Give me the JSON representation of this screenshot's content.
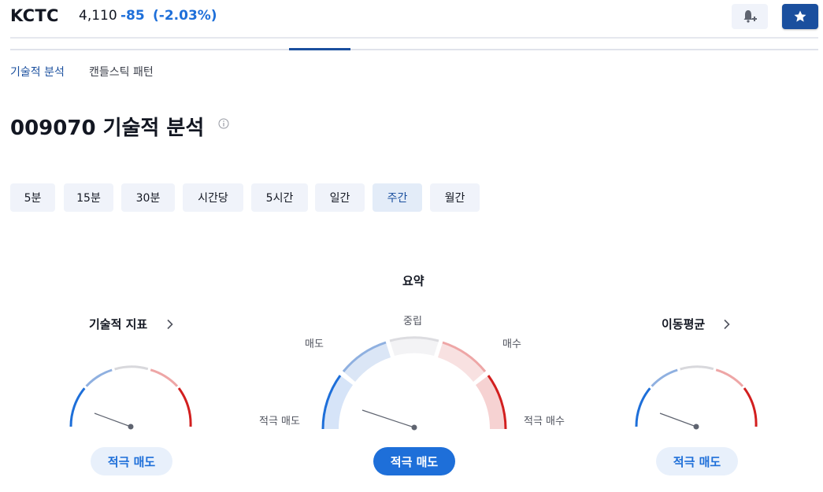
{
  "header": {
    "ticker": "KCTC",
    "price": "4,110",
    "change": "-85",
    "change_pct": "(-2.03%)",
    "alert_icon": "bell-plus-icon",
    "favorite_icon": "star-icon",
    "colors": {
      "accent": "#1e6fd9",
      "brand_dark": "#1a4f9e"
    }
  },
  "subtabs": [
    {
      "label": "기술적 분석",
      "active": true
    },
    {
      "label": "캔들스틱 패턴",
      "active": false
    }
  ],
  "page": {
    "title": "009070 기술적 분석",
    "info_icon": "info-icon"
  },
  "periods": [
    {
      "label": "5분",
      "selected": false
    },
    {
      "label": "15분",
      "selected": false
    },
    {
      "label": "30분",
      "selected": false
    },
    {
      "label": "시간당",
      "selected": false
    },
    {
      "label": "5시간",
      "selected": false
    },
    {
      "label": "일간",
      "selected": false
    },
    {
      "label": "주간",
      "selected": true
    },
    {
      "label": "월간",
      "selected": false
    }
  ],
  "gauges": {
    "oscillators": {
      "title": "기술적 지표",
      "rating": "적극 매도"
    },
    "summary": {
      "title": "요약",
      "rating": "적극 매도",
      "scale_labels": {
        "strong_sell": "적극 매도",
        "sell": "매도",
        "neutral": "중립",
        "buy": "매수",
        "strong_buy": "적극 매수"
      }
    },
    "moving_averages": {
      "title": "이동평균",
      "rating": "적극 매도"
    }
  }
}
